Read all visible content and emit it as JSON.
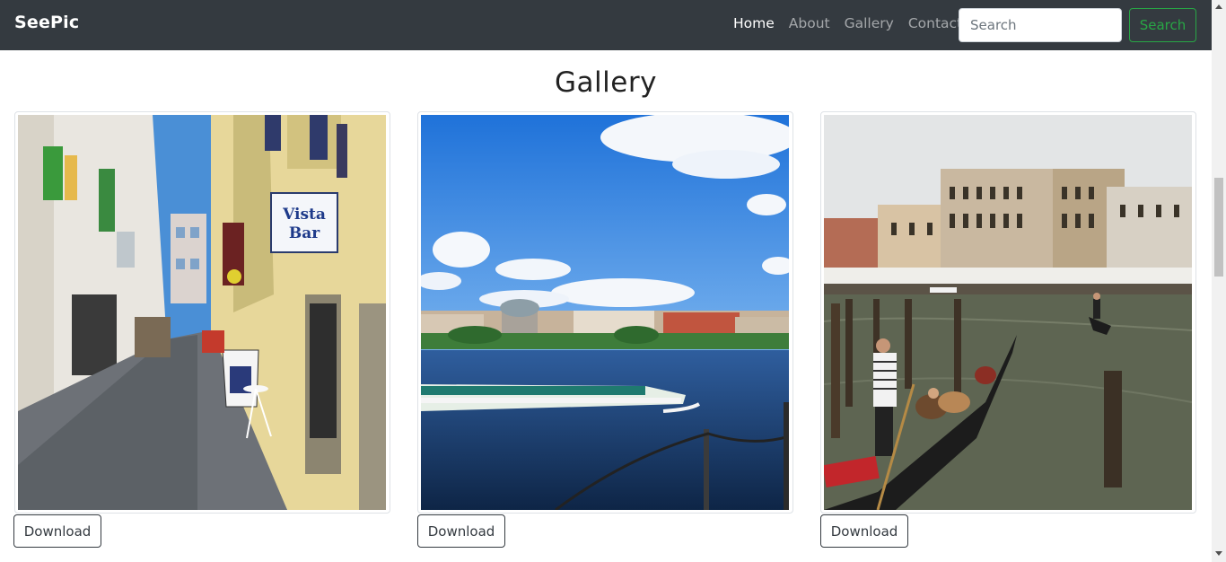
{
  "nav": {
    "brand": "SeePic",
    "links": [
      "Home",
      "About",
      "Gallery",
      "Contact"
    ],
    "search_placeholder": "Search",
    "search_button": "Search"
  },
  "page": {
    "heading": "Gallery"
  },
  "gallery": {
    "download_label": "Download",
    "photos": [
      {
        "scene": "narrow cobblestone alley",
        "sign_text": "Vista Bar"
      },
      {
        "scene": "lake with ferry boat and city skyline"
      },
      {
        "scene": "canal with gondolas and historic buildings"
      }
    ]
  },
  "colors": {
    "navbar": "#343a40",
    "success": "#28a745"
  }
}
